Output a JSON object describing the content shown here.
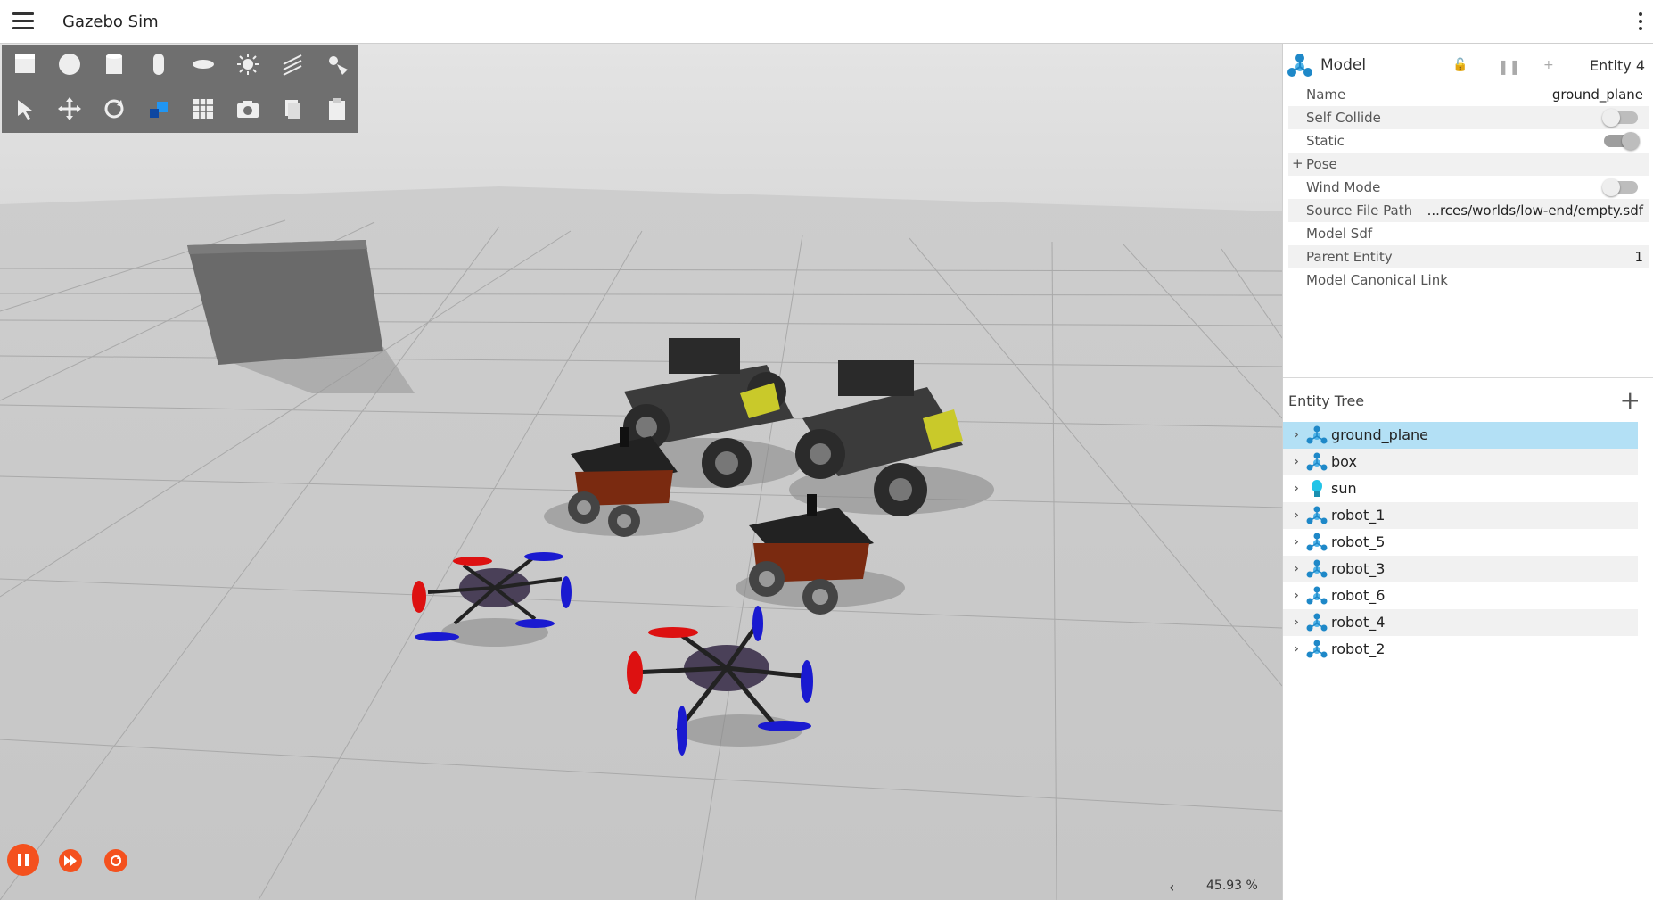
{
  "app": {
    "title": "Gazebo Sim"
  },
  "toolbar": {
    "shapes": [
      "box-icon",
      "sphere-icon",
      "cylinder-icon",
      "capsule-icon",
      "ellipsoid-icon",
      "point-light-icon",
      "directional-light-icon",
      "spot-light-icon"
    ],
    "tools": [
      "select-icon",
      "translate-icon",
      "rotate-icon",
      "view-angle-icon",
      "grid-snap-icon",
      "screenshot-icon",
      "copy-icon",
      "paste-icon"
    ]
  },
  "sim": {
    "rtf": "45.93 %",
    "collapse_arrow": "‹"
  },
  "component_inspector": {
    "type": "Model",
    "entity": "Entity 4",
    "properties": [
      {
        "label": "Name",
        "value": "ground_plane"
      },
      {
        "label": "Self Collide",
        "toggle": "off"
      },
      {
        "label": "Static",
        "toggle": "on"
      },
      {
        "label": "Pose",
        "prefix": "+"
      },
      {
        "label": "Wind Mode",
        "toggle": "off"
      },
      {
        "label": "Source File Path",
        "value": "...rces/worlds/low-end/empty.sdf"
      },
      {
        "label": "Model Sdf"
      },
      {
        "label": "Parent Entity",
        "value": "1"
      },
      {
        "label": "Model Canonical Link"
      }
    ]
  },
  "entity_tree": {
    "title": "Entity Tree",
    "add": "+",
    "items": [
      {
        "label": "ground_plane",
        "icon": "model-icon",
        "selected": true
      },
      {
        "label": "box",
        "icon": "model-icon"
      },
      {
        "label": "sun",
        "icon": "light-bulb-icon"
      },
      {
        "label": "robot_1",
        "icon": "model-icon"
      },
      {
        "label": "robot_5",
        "icon": "model-icon"
      },
      {
        "label": "robot_3",
        "icon": "model-icon"
      },
      {
        "label": "robot_6",
        "icon": "model-icon"
      },
      {
        "label": "robot_4",
        "icon": "model-icon"
      },
      {
        "label": "robot_2",
        "icon": "model-icon"
      }
    ]
  },
  "colors": {
    "accent": "#f4511e",
    "selection": "#b3e0f5",
    "model_icon": "#1e88c8"
  }
}
